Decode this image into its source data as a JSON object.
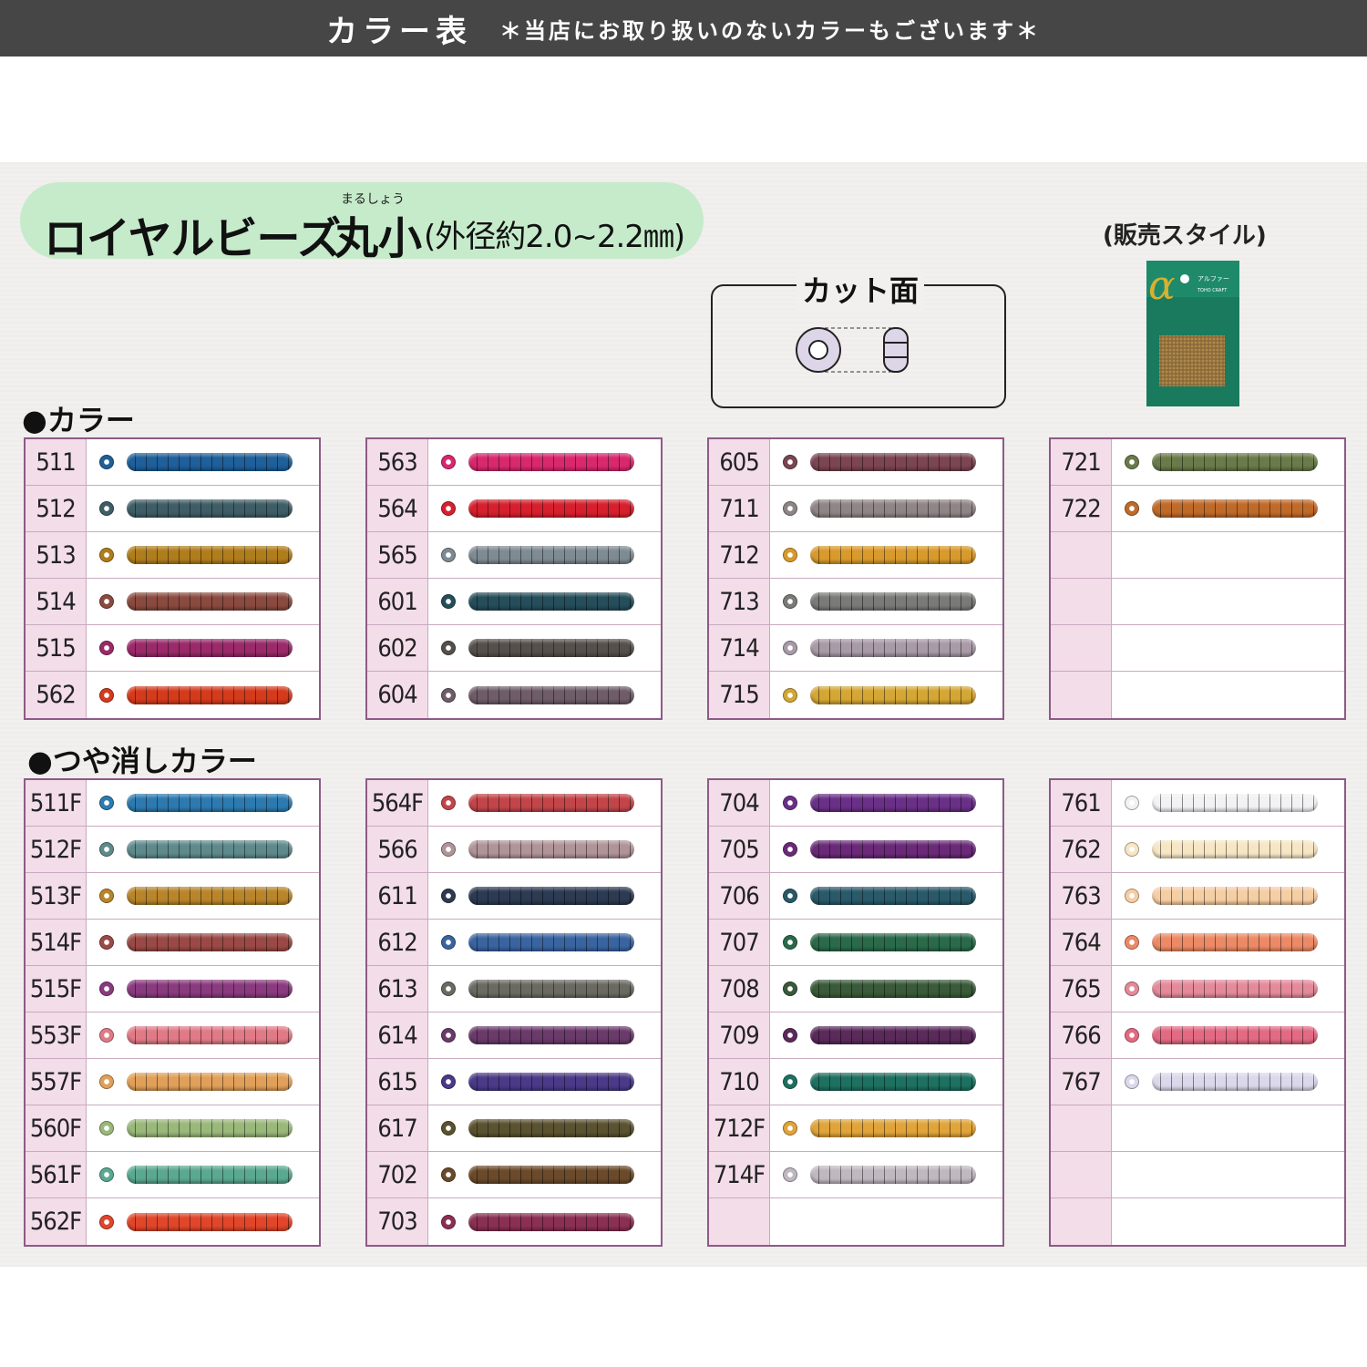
{
  "header": {
    "title": "カラー表",
    "note": "＊当店にお取り扱いのないカラーもございます＊"
  },
  "catalog": {
    "product_name": "ロイヤルビーズ",
    "shape_ruby": "まるしょう",
    "shape": "丸小",
    "size_spec": "(外径約2.0~2.2㎜)",
    "cut_label": "カット面",
    "sales_style_label": "(販売スタイル)",
    "package_brand": "アルファー",
    "package_maker": "TOHO CRAFT"
  },
  "sections": {
    "color_title": "●カラー",
    "matte_title": "●つや消しカラー"
  },
  "color_tables": [
    [
      {
        "code": "511",
        "color": "#1f5f9a"
      },
      {
        "code": "512",
        "color": "#3f5d66"
      },
      {
        "code": "513",
        "color": "#b07d1c"
      },
      {
        "code": "514",
        "color": "#8a4a3f"
      },
      {
        "code": "515",
        "color": "#9a2a6a"
      },
      {
        "code": "562",
        "color": "#d43a1c"
      }
    ],
    [
      {
        "code": "563",
        "color": "#d8286e"
      },
      {
        "code": "564",
        "color": "#d6202e"
      },
      {
        "code": "565",
        "color": "#7e8b92"
      },
      {
        "code": "601",
        "color": "#254e5a"
      },
      {
        "code": "602",
        "color": "#56504c"
      },
      {
        "code": "604",
        "color": "#6e5c68"
      }
    ],
    [
      {
        "code": "605",
        "color": "#7b4552"
      },
      {
        "code": "711",
        "color": "#8f8586"
      },
      {
        "code": "712",
        "color": "#d89a2c"
      },
      {
        "code": "713",
        "color": "#7a7a78"
      },
      {
        "code": "714",
        "color": "#a89aa6"
      },
      {
        "code": "715",
        "color": "#d4a634"
      }
    ],
    [
      {
        "code": "721",
        "color": "#6b7a4a"
      },
      {
        "code": "722",
        "color": "#c06a2a"
      },
      {
        "code": "",
        "color": ""
      },
      {
        "code": "",
        "color": ""
      },
      {
        "code": "",
        "color": ""
      },
      {
        "code": "",
        "color": ""
      }
    ]
  ],
  "matte_tables": [
    [
      {
        "code": "511F",
        "color": "#2d7ab0"
      },
      {
        "code": "512F",
        "color": "#5f8a8c"
      },
      {
        "code": "513F",
        "color": "#b8852a"
      },
      {
        "code": "514F",
        "color": "#9a4a46"
      },
      {
        "code": "515F",
        "color": "#8a3a7e"
      },
      {
        "code": "553F",
        "color": "#e07a86"
      },
      {
        "code": "557F",
        "color": "#e0a05a"
      },
      {
        "code": "560F",
        "color": "#9ab87a"
      },
      {
        "code": "561F",
        "color": "#5aa890"
      },
      {
        "code": "562F",
        "color": "#e0462a"
      }
    ],
    [
      {
        "code": "564F",
        "color": "#c2454a"
      },
      {
        "code": "566",
        "color": "#b09498"
      },
      {
        "code": "611",
        "color": "#2c3a52"
      },
      {
        "code": "612",
        "color": "#3a64a0"
      },
      {
        "code": "613",
        "color": "#6a6a62"
      },
      {
        "code": "614",
        "color": "#6a3a6a"
      },
      {
        "code": "615",
        "color": "#4a3a88"
      },
      {
        "code": "617",
        "color": "#5a5230"
      },
      {
        "code": "702",
        "color": "#6a4a2a"
      },
      {
        "code": "703",
        "color": "#8a3052"
      }
    ],
    [
      {
        "code": "704",
        "color": "#6a3088"
      },
      {
        "code": "705",
        "color": "#6a2a78"
      },
      {
        "code": "706",
        "color": "#2a5a6a"
      },
      {
        "code": "707",
        "color": "#2a6a4a"
      },
      {
        "code": "708",
        "color": "#3a5a3a"
      },
      {
        "code": "709",
        "color": "#5a2a5a"
      },
      {
        "code": "710",
        "color": "#1e7060"
      },
      {
        "code": "712F",
        "color": "#e0a43a"
      },
      {
        "code": "714F",
        "color": "#c0b8c0"
      },
      {
        "code": "",
        "color": ""
      }
    ],
    [
      {
        "code": "761",
        "color": "#f2f2f4"
      },
      {
        "code": "762",
        "color": "#f6e6c4"
      },
      {
        "code": "763",
        "color": "#f6cea4"
      },
      {
        "code": "764",
        "color": "#ec8a66"
      },
      {
        "code": "765",
        "color": "#e48a9a"
      },
      {
        "code": "766",
        "color": "#e26a82"
      },
      {
        "code": "767",
        "color": "#dcd8ec"
      },
      {
        "code": "",
        "color": ""
      },
      {
        "code": "",
        "color": ""
      },
      {
        "code": "",
        "color": ""
      }
    ]
  ]
}
